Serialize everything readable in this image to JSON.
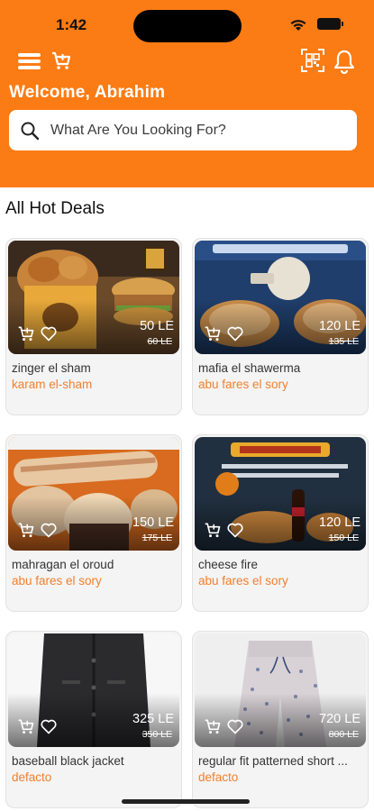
{
  "status_bar": {
    "time": "1:42"
  },
  "header": {
    "welcome": "Welcome, Abrahim",
    "search_placeholder": "What Are You Looking For?",
    "icons": [
      "menu-icon",
      "cart-icon",
      "qr-scan-icon",
      "bell-icon"
    ]
  },
  "section": {
    "title": "All Hot Deals"
  },
  "colors": {
    "brand": "#fb7b14",
    "vendor_text": "#f27f2b",
    "card_bg": "#f4f4f4"
  },
  "deals": [
    {
      "name": "zinger el sham",
      "vendor": "karam el-sham",
      "price": "50 LE",
      "old_price": "60 LE",
      "image": "fried-chicken-burger-meal"
    },
    {
      "name": "mafia el shawerma",
      "vendor": "abu fares el sory",
      "price": "120 LE",
      "old_price": "135 LE",
      "image": "shawarma-plates-offer"
    },
    {
      "name": "mahragan el oroud",
      "vendor": "abu fares el sory",
      "price": "150 LE",
      "old_price": "175 LE",
      "image": "shawarma-wraps-platter"
    },
    {
      "name": "cheese fire",
      "vendor": "abu fares el sory",
      "price": "120 LE",
      "old_price": "150 LE",
      "image": "cheese-fire-offer-cola"
    },
    {
      "name": "baseball black jacket",
      "vendor": "defacto",
      "price": "325 LE",
      "old_price": "350 LE",
      "image": "black-jacket"
    },
    {
      "name": "regular fit patterned short ...",
      "vendor": "defacto",
      "price": "720 LE",
      "old_price": "800 LE",
      "image": "patterned-pajama-shorts"
    }
  ]
}
